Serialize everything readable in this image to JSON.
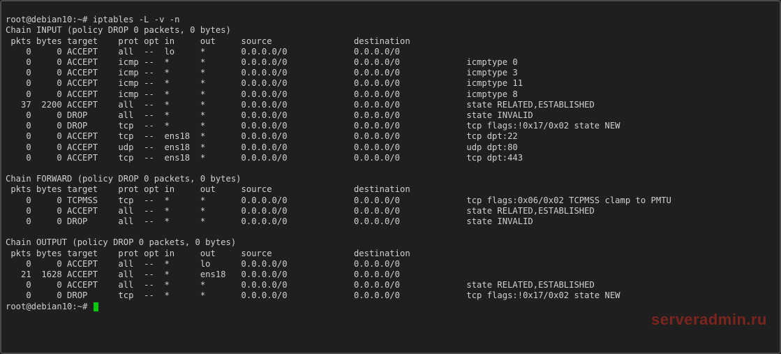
{
  "prompt1_user": "root@debian10",
  "prompt1_path": ":~#",
  "command": "iptables -L -v -n",
  "prompt2_user": "root@debian10",
  "prompt2_path": ":~#",
  "watermark": "serveradmin.ru",
  "chains": [
    {
      "title": "Chain INPUT (policy DROP 0 packets, 0 bytes)",
      "header": {
        "pkts": "pkts",
        "bytes": "bytes",
        "target": "target",
        "prot": "prot",
        "opt": "opt",
        "in": "in",
        "out": "out",
        "source": "source",
        "destination": "destination"
      },
      "rules": [
        {
          "pkts": "0",
          "bytes": "0",
          "target": "ACCEPT",
          "prot": "all",
          "opt": "--",
          "in": "lo",
          "out": "*",
          "source": "0.0.0.0/0",
          "destination": "0.0.0.0/0",
          "extra": ""
        },
        {
          "pkts": "0",
          "bytes": "0",
          "target": "ACCEPT",
          "prot": "icmp",
          "opt": "--",
          "in": "*",
          "out": "*",
          "source": "0.0.0.0/0",
          "destination": "0.0.0.0/0",
          "extra": "icmptype 0"
        },
        {
          "pkts": "0",
          "bytes": "0",
          "target": "ACCEPT",
          "prot": "icmp",
          "opt": "--",
          "in": "*",
          "out": "*",
          "source": "0.0.0.0/0",
          "destination": "0.0.0.0/0",
          "extra": "icmptype 3"
        },
        {
          "pkts": "0",
          "bytes": "0",
          "target": "ACCEPT",
          "prot": "icmp",
          "opt": "--",
          "in": "*",
          "out": "*",
          "source": "0.0.0.0/0",
          "destination": "0.0.0.0/0",
          "extra": "icmptype 11"
        },
        {
          "pkts": "0",
          "bytes": "0",
          "target": "ACCEPT",
          "prot": "icmp",
          "opt": "--",
          "in": "*",
          "out": "*",
          "source": "0.0.0.0/0",
          "destination": "0.0.0.0/0",
          "extra": "icmptype 8"
        },
        {
          "pkts": "37",
          "bytes": "2200",
          "target": "ACCEPT",
          "prot": "all",
          "opt": "--",
          "in": "*",
          "out": "*",
          "source": "0.0.0.0/0",
          "destination": "0.0.0.0/0",
          "extra": "state RELATED,ESTABLISHED"
        },
        {
          "pkts": "0",
          "bytes": "0",
          "target": "DROP",
          "prot": "all",
          "opt": "--",
          "in": "*",
          "out": "*",
          "source": "0.0.0.0/0",
          "destination": "0.0.0.0/0",
          "extra": "state INVALID"
        },
        {
          "pkts": "0",
          "bytes": "0",
          "target": "DROP",
          "prot": "tcp",
          "opt": "--",
          "in": "*",
          "out": "*",
          "source": "0.0.0.0/0",
          "destination": "0.0.0.0/0",
          "extra": "tcp flags:!0x17/0x02 state NEW"
        },
        {
          "pkts": "0",
          "bytes": "0",
          "target": "ACCEPT",
          "prot": "tcp",
          "opt": "--",
          "in": "ens18",
          "out": "*",
          "source": "0.0.0.0/0",
          "destination": "0.0.0.0/0",
          "extra": "tcp dpt:22"
        },
        {
          "pkts": "0",
          "bytes": "0",
          "target": "ACCEPT",
          "prot": "udp",
          "opt": "--",
          "in": "ens18",
          "out": "*",
          "source": "0.0.0.0/0",
          "destination": "0.0.0.0/0",
          "extra": "udp dpt:80"
        },
        {
          "pkts": "0",
          "bytes": "0",
          "target": "ACCEPT",
          "prot": "tcp",
          "opt": "--",
          "in": "ens18",
          "out": "*",
          "source": "0.0.0.0/0",
          "destination": "0.0.0.0/0",
          "extra": "tcp dpt:443"
        }
      ]
    },
    {
      "title": "Chain FORWARD (policy DROP 0 packets, 0 bytes)",
      "header": {
        "pkts": "pkts",
        "bytes": "bytes",
        "target": "target",
        "prot": "prot",
        "opt": "opt",
        "in": "in",
        "out": "out",
        "source": "source",
        "destination": "destination"
      },
      "rules": [
        {
          "pkts": "0",
          "bytes": "0",
          "target": "TCPMSS",
          "prot": "tcp",
          "opt": "--",
          "in": "*",
          "out": "*",
          "source": "0.0.0.0/0",
          "destination": "0.0.0.0/0",
          "extra": "tcp flags:0x06/0x02 TCPMSS clamp to PMTU"
        },
        {
          "pkts": "0",
          "bytes": "0",
          "target": "ACCEPT",
          "prot": "all",
          "opt": "--",
          "in": "*",
          "out": "*",
          "source": "0.0.0.0/0",
          "destination": "0.0.0.0/0",
          "extra": "state RELATED,ESTABLISHED"
        },
        {
          "pkts": "0",
          "bytes": "0",
          "target": "DROP",
          "prot": "all",
          "opt": "--",
          "in": "*",
          "out": "*",
          "source": "0.0.0.0/0",
          "destination": "0.0.0.0/0",
          "extra": "state INVALID"
        }
      ]
    },
    {
      "title": "Chain OUTPUT (policy DROP 0 packets, 0 bytes)",
      "header": {
        "pkts": "pkts",
        "bytes": "bytes",
        "target": "target",
        "prot": "prot",
        "opt": "opt",
        "in": "in",
        "out": "out",
        "source": "source",
        "destination": "destination"
      },
      "rules": [
        {
          "pkts": "0",
          "bytes": "0",
          "target": "ACCEPT",
          "prot": "all",
          "opt": "--",
          "in": "*",
          "out": "lo",
          "source": "0.0.0.0/0",
          "destination": "0.0.0.0/0",
          "extra": ""
        },
        {
          "pkts": "21",
          "bytes": "1628",
          "target": "ACCEPT",
          "prot": "all",
          "opt": "--",
          "in": "*",
          "out": "ens18",
          "source": "0.0.0.0/0",
          "destination": "0.0.0.0/0",
          "extra": ""
        },
        {
          "pkts": "0",
          "bytes": "0",
          "target": "ACCEPT",
          "prot": "all",
          "opt": "--",
          "in": "*",
          "out": "*",
          "source": "0.0.0.0/0",
          "destination": "0.0.0.0/0",
          "extra": "state RELATED,ESTABLISHED"
        },
        {
          "pkts": "0",
          "bytes": "0",
          "target": "DROP",
          "prot": "tcp",
          "opt": "--",
          "in": "*",
          "out": "*",
          "source": "0.0.0.0/0",
          "destination": "0.0.0.0/0",
          "extra": "tcp flags:!0x17/0x02 state NEW"
        }
      ]
    }
  ]
}
